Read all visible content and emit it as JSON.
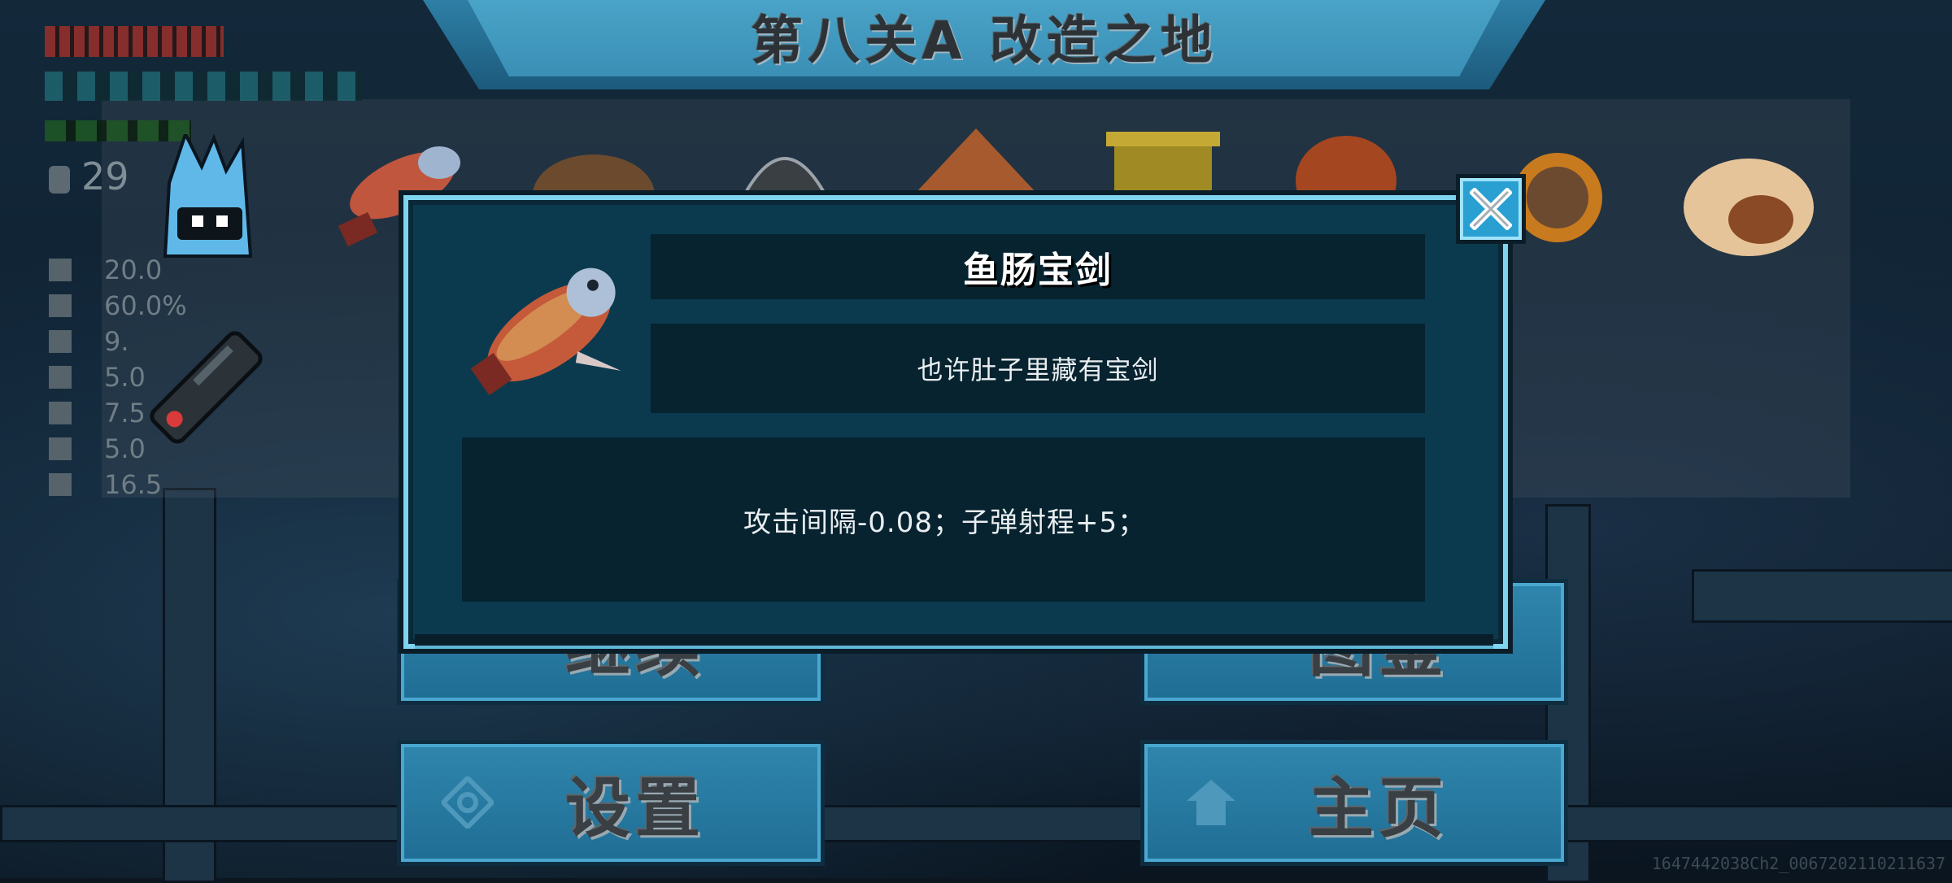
{
  "level_title": "第八关A  改造之地",
  "hud": {
    "coins": "29",
    "stats": [
      "20.0",
      "60.0%",
      "9.",
      "5.0",
      "7.5",
      "5.0",
      "16.5"
    ]
  },
  "item_row": {
    "items": [
      "fish",
      "cookie",
      "helmet",
      "cone-hat",
      "gold-pot",
      "red-pie",
      "sun-mask",
      "dumpling"
    ]
  },
  "dialog": {
    "item_name": "鱼肠宝剑",
    "description": "也许肚子里藏有宝剑",
    "effect": "攻击间隔-0.08；子弹射程+5；",
    "close_icon": "close-icon"
  },
  "menu": {
    "continue_label": "继续",
    "gallery_label": "图鉴",
    "settings_label": "设置",
    "home_label": "主页"
  },
  "watermark": "1647442038Ch2_0067202110211637",
  "colors": {
    "panel": "#0b3a4e",
    "panel_border": "#7fd4f0",
    "button": "#2f86ad",
    "close_button": "#2aa0d2"
  }
}
